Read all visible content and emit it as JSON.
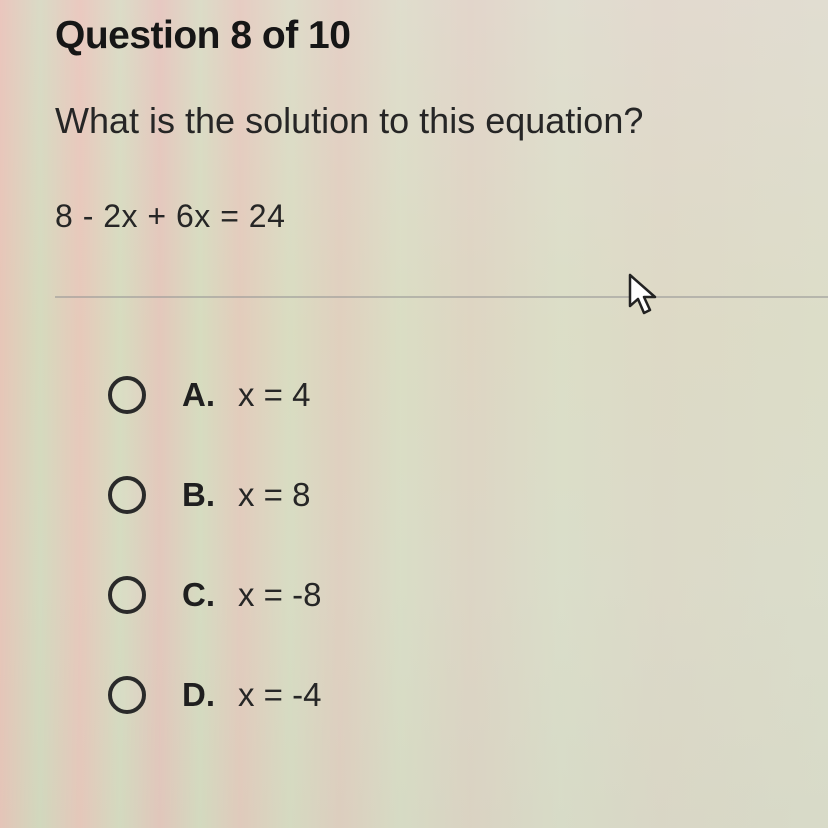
{
  "question": {
    "header": "Question 8 of 10",
    "prompt": "What is the solution to this equation?",
    "equation": "8 - 2x + 6x = 24"
  },
  "choices": [
    {
      "letter": "A.",
      "text": "x = 4"
    },
    {
      "letter": "B.",
      "text": "x = 8"
    },
    {
      "letter": "C.",
      "text": "x = -8"
    },
    {
      "letter": "D.",
      "text": "x = -4"
    }
  ],
  "icons": {
    "cursor": "mouse-pointer-icon",
    "radio": "radio-button-unselected-icon"
  }
}
